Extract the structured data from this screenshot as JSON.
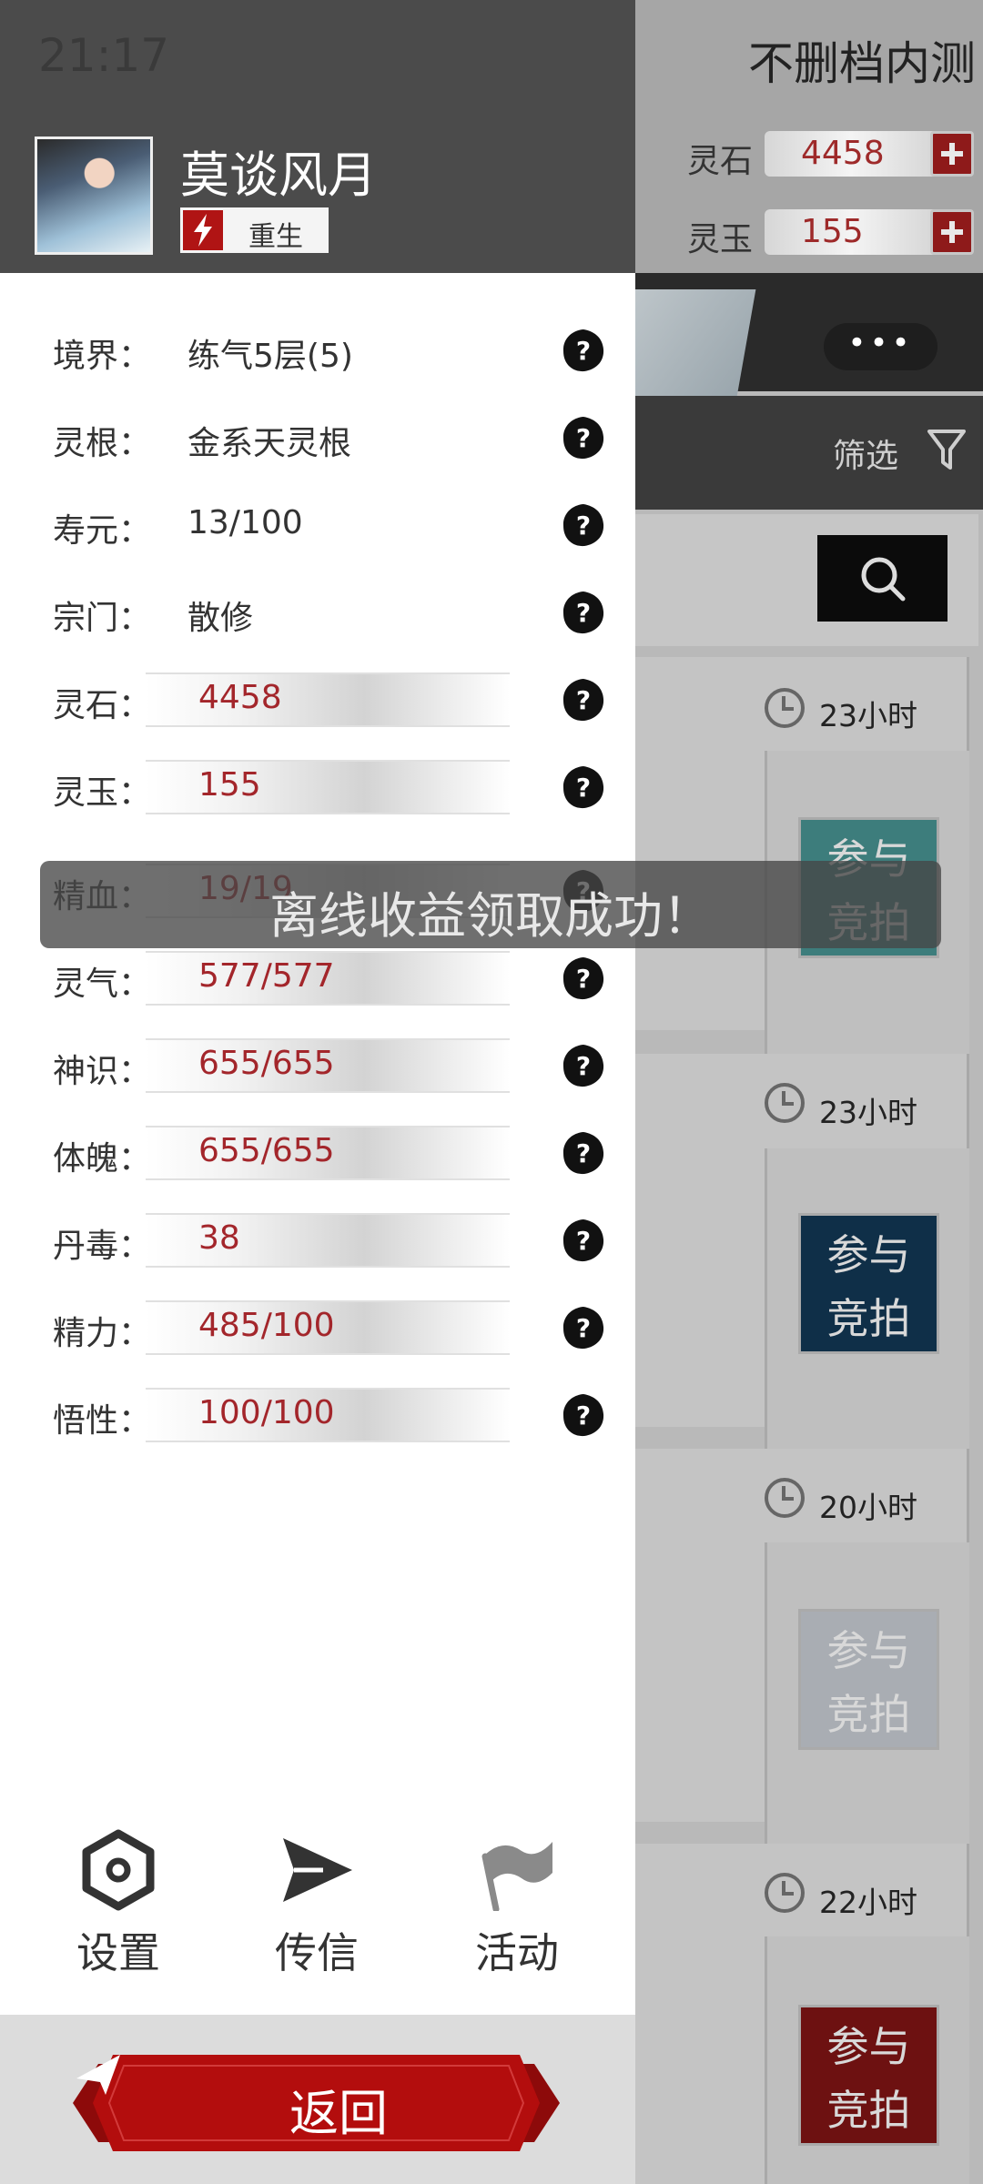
{
  "status_bar": {
    "time": "21:17"
  },
  "background": {
    "title": "不删档内测",
    "resources": [
      {
        "label": "灵石",
        "value": "4458"
      },
      {
        "label": "灵玉",
        "value": "155"
      }
    ],
    "more_label": "•••",
    "filter_label": "筛选",
    "auction_cards": [
      {
        "timer": "23小时",
        "bid_label": "参与竞拍",
        "accent": "#3d7d7c"
      },
      {
        "timer": "23小时",
        "bid_label": "参与竞拍",
        "accent": "#0f2f48"
      },
      {
        "timer": "20小时",
        "bid_label": "参与竞拍",
        "accent": "#a9adb3"
      },
      {
        "timer": "22小时",
        "bid_label": "参与竞拍",
        "accent": "#6d1111"
      }
    ]
  },
  "drawer": {
    "user": {
      "name": "莫谈风月",
      "badge": "重生"
    },
    "stats": [
      {
        "label": "境界：",
        "value": "练气5层(5)",
        "style": "plain"
      },
      {
        "label": "灵根：",
        "value": "金系天灵根",
        "style": "plain"
      },
      {
        "label": "寿元：",
        "value": "13/100",
        "style": "plain"
      },
      {
        "label": "宗门：",
        "value": "散修",
        "style": "plain"
      },
      {
        "label": "灵石：",
        "value": "4458",
        "style": "bar"
      },
      {
        "label": "灵玉：",
        "value": "155",
        "style": "bar"
      },
      {
        "label": "精血：",
        "value": "19/19",
        "style": "bar"
      },
      {
        "label": "灵气：",
        "value": "577/577",
        "style": "bar"
      },
      {
        "label": "神识：",
        "value": "655/655",
        "style": "bar"
      },
      {
        "label": "体魄：",
        "value": "655/655",
        "style": "bar"
      },
      {
        "label": "丹毒：",
        "value": "38",
        "style": "bar"
      },
      {
        "label": "精力：",
        "value": "485/100",
        "style": "bar"
      },
      {
        "label": "悟性：",
        "value": "100/100",
        "style": "bar"
      }
    ],
    "nav": [
      {
        "label": "设置",
        "icon": "gear-icon"
      },
      {
        "label": "传信",
        "icon": "send-icon"
      },
      {
        "label": "活动",
        "icon": "flag-icon"
      }
    ],
    "back_label": "返回"
  },
  "toast": {
    "message": "离线收益领取成功！"
  },
  "colors": {
    "accent_red": "#a3262b",
    "button_red": "#b10d0d",
    "header_dark": "#4b4b4b"
  }
}
